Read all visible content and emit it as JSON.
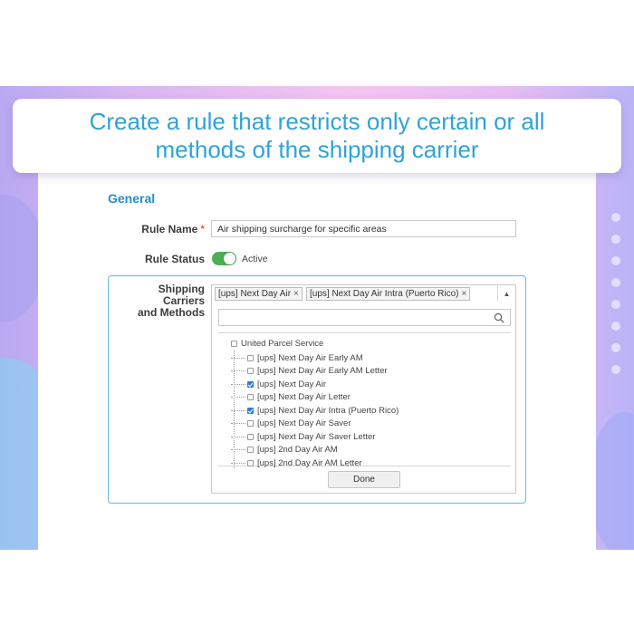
{
  "banner": {
    "line1": "Create a rule that restricts only certain or all",
    "line2": "methods of the shipping carrier"
  },
  "form": {
    "section_title": "General",
    "rule_name_label": "Rule Name",
    "required_mark": "*",
    "rule_name_value": "Air shipping surcharge for specific areas",
    "rule_status_label": "Rule Status",
    "rule_status_text": "Active",
    "rule_status_on": true,
    "carriers_label_line1": "Shipping Carriers",
    "carriers_label_line2": "and Methods"
  },
  "selected_chips": [
    {
      "label": "[ups] Next Day Air",
      "remove": "×"
    },
    {
      "label": "[ups] Next Day Air Intra (Puerto Rico)",
      "remove": "×"
    }
  ],
  "dropdown": {
    "search_value": "",
    "root": {
      "label": "United Parcel Service",
      "checked": false
    },
    "items": [
      {
        "label": "[ups] Next Day Air Early AM",
        "checked": false
      },
      {
        "label": "[ups] Next Day Air Early AM Letter",
        "checked": false
      },
      {
        "label": "[ups] Next Day Air",
        "checked": true
      },
      {
        "label": "[ups] Next Day Air Letter",
        "checked": false
      },
      {
        "label": "[ups] Next Day Air Intra (Puerto Rico)",
        "checked": true
      },
      {
        "label": "[ups] Next Day Air Saver",
        "checked": false
      },
      {
        "label": "[ups] Next Day Air Saver Letter",
        "checked": false
      },
      {
        "label": "[ups] 2nd Day Air AM",
        "checked": false
      },
      {
        "label": "[ups] 2nd Day Air AM Letter",
        "checked": false
      }
    ],
    "done_label": "Done"
  },
  "icons": {
    "search": "search-icon",
    "arrow": "chevron-up-icon"
  },
  "colors": {
    "accent": "#2ea3d9",
    "toggle_on": "#4caf50",
    "checkbox": "#2f7fd3",
    "required": "#e22626"
  }
}
